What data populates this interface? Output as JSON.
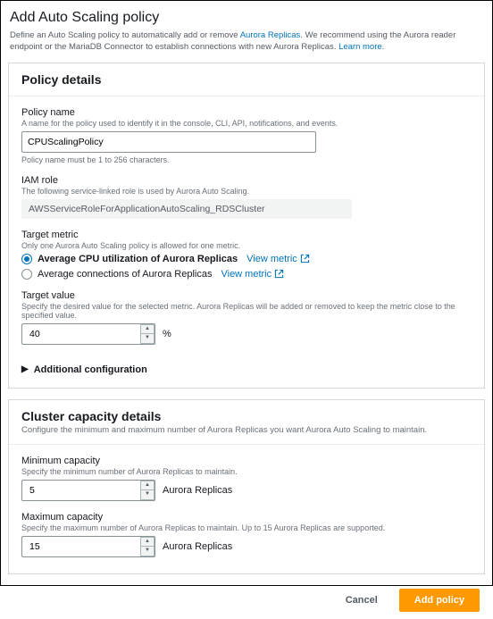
{
  "header": {
    "title": "Add Auto Scaling policy",
    "desc_pre": "Define an Auto Scaling policy to automatically add or remove ",
    "desc_link1": "Aurora Replicas",
    "desc_mid": ". We recommend using the Aurora reader endpoint or the MariaDB Connector to establish connections with new Aurora Replicas. ",
    "desc_link2": "Learn more",
    "desc_post": "."
  },
  "policy": {
    "panel_title": "Policy details",
    "name_label": "Policy name",
    "name_help": "A name for the policy used to identify it in the console, CLI, API, notifications, and events.",
    "name_value": "CPUScalingPolicy",
    "name_constraint": "Policy name must be 1 to 256 characters.",
    "iam_label": "IAM role",
    "iam_help": "The following service-linked role is used by Aurora Auto Scaling.",
    "iam_value": "AWSServiceRoleForApplicationAutoScaling_RDSCluster",
    "metric_label": "Target metric",
    "metric_help": "Only one Aurora Auto Scaling policy is allowed for one metric.",
    "metric_opt1": "Average CPU utilization of Aurora Replicas",
    "metric_opt2": "Average connections of Aurora Replicas",
    "view_metric": "View metric",
    "target_label": "Target value",
    "target_help": "Specify the desired value for the selected metric. Aurora Replicas will be added or removed to keep the metric close to the specified value.",
    "target_value": "40",
    "target_unit": "%",
    "additional": "Additional configuration"
  },
  "cluster": {
    "panel_title": "Cluster capacity details",
    "panel_desc": "Configure the minimum and maximum number of Aurora Replicas you want Aurora Auto Scaling to maintain.",
    "min_label": "Minimum capacity",
    "min_help": "Specify the minimum number of Aurora Replicas to maintain.",
    "min_value": "5",
    "max_label": "Maximum capacity",
    "max_help": "Specify the maximum number of Aurora Replicas to maintain. Up to 15 Aurora Replicas are supported.",
    "max_value": "15",
    "unit": "Aurora Replicas"
  },
  "footer": {
    "cancel": "Cancel",
    "submit": "Add policy"
  }
}
